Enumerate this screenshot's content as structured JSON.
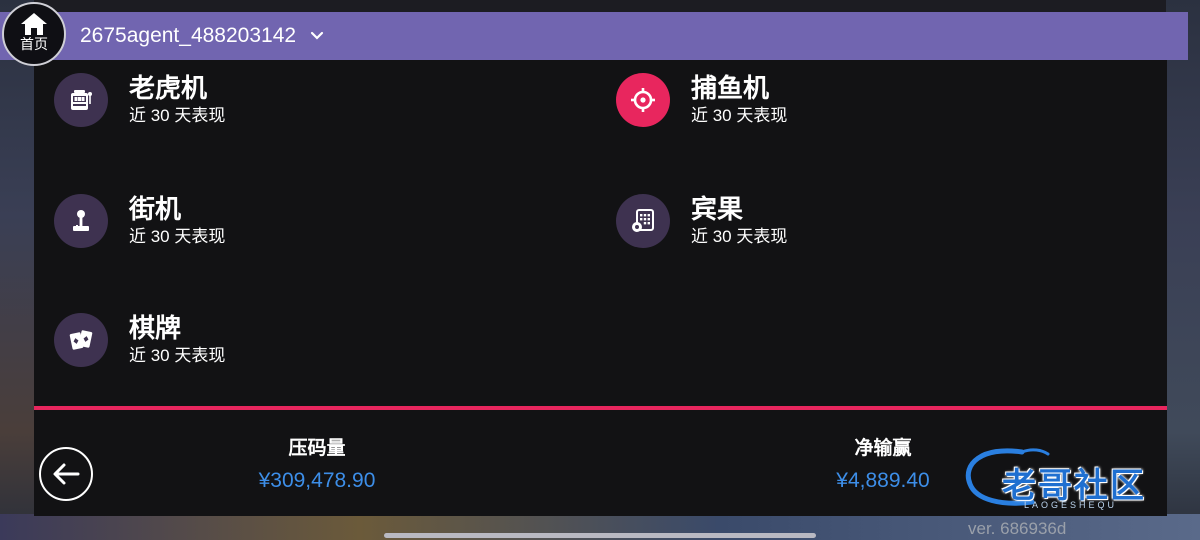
{
  "header": {
    "home_label": "首页",
    "account": "2675agent_488203142"
  },
  "games": [
    {
      "name": "老虎机",
      "sub": "近 30 天表现",
      "icon": "slot-machine-icon"
    },
    {
      "name": "捕鱼机",
      "sub": "近 30 天表现",
      "icon": "crosshair-icon"
    },
    {
      "name": "街机",
      "sub": "近 30 天表现",
      "icon": "joystick-icon"
    },
    {
      "name": "宾果",
      "sub": "近 30 天表现",
      "icon": "bingo-card-icon"
    },
    {
      "name": "棋牌",
      "sub": "近 30 天表现",
      "icon": "playing-cards-icon"
    }
  ],
  "stats": {
    "bet_label": "压码量",
    "bet_value": "¥309,478.90",
    "net_label": "净输赢",
    "net_value": "¥4,889.40"
  },
  "watermark": {
    "text": "老哥社区",
    "sub": "LAOGESHEQU"
  },
  "version": "ver. 686936d",
  "colors": {
    "header_bg": "#7165b0",
    "accent": "#e8265e",
    "value_blue": "#3d8ee8",
    "icon_bg": "#3e3250"
  }
}
